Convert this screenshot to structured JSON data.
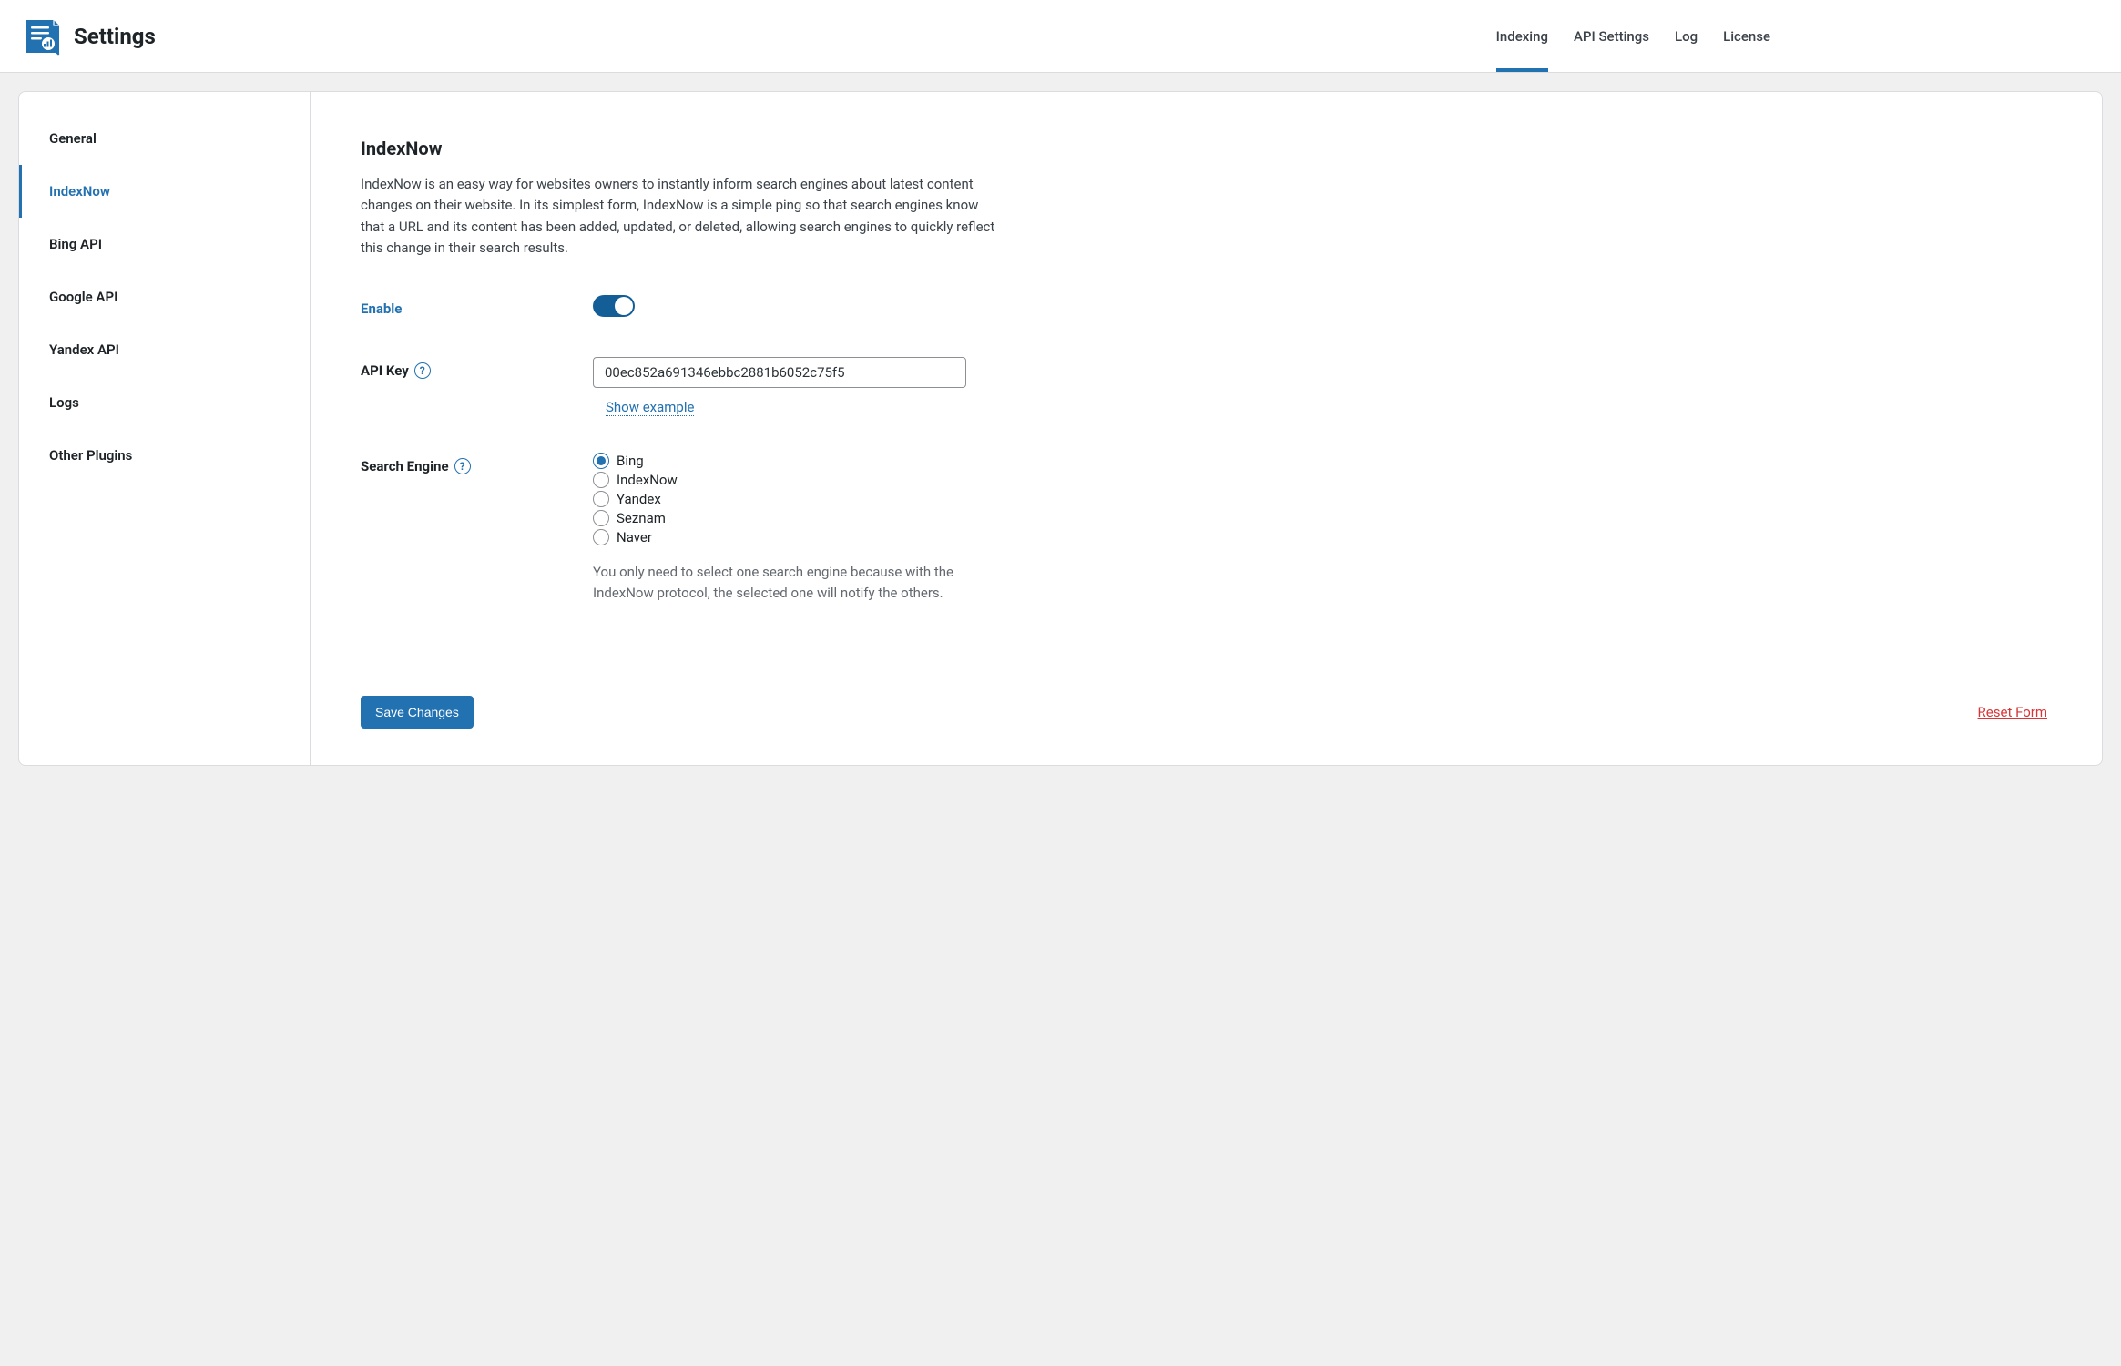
{
  "header": {
    "title": "Settings",
    "nav": {
      "indexing": "Indexing",
      "api_settings": "API Settings",
      "log": "Log",
      "license": "License"
    }
  },
  "sidebar": {
    "general": "General",
    "indexnow": "IndexNow",
    "bing_api": "Bing API",
    "google_api": "Google API",
    "yandex_api": "Yandex API",
    "logs": "Logs",
    "other_plugins": "Other Plugins"
  },
  "section": {
    "title": "IndexNow",
    "description": "IndexNow is an easy way for websites owners to instantly inform search engines about latest content changes on their website. In its simplest form, IndexNow is a simple ping so that search engines know that a URL and its content has been added, updated, or deleted, allowing search engines to quickly reflect this change in their search results."
  },
  "form": {
    "enable_label": "Enable",
    "api_key_label": "API Key",
    "api_key_value": "00ec852a691346ebbc2881b6052c75f5",
    "show_example": "Show example",
    "search_engine_label": "Search Engine",
    "engines": {
      "bing": "Bing",
      "indexnow": "IndexNow",
      "yandex": "Yandex",
      "seznam": "Seznam",
      "naver": "Naver"
    },
    "engine_hint": "You only need to select one search engine because with the IndexNow protocol, the selected one will notify the others.",
    "save_button": "Save Changes",
    "reset_link": "Reset Form"
  }
}
